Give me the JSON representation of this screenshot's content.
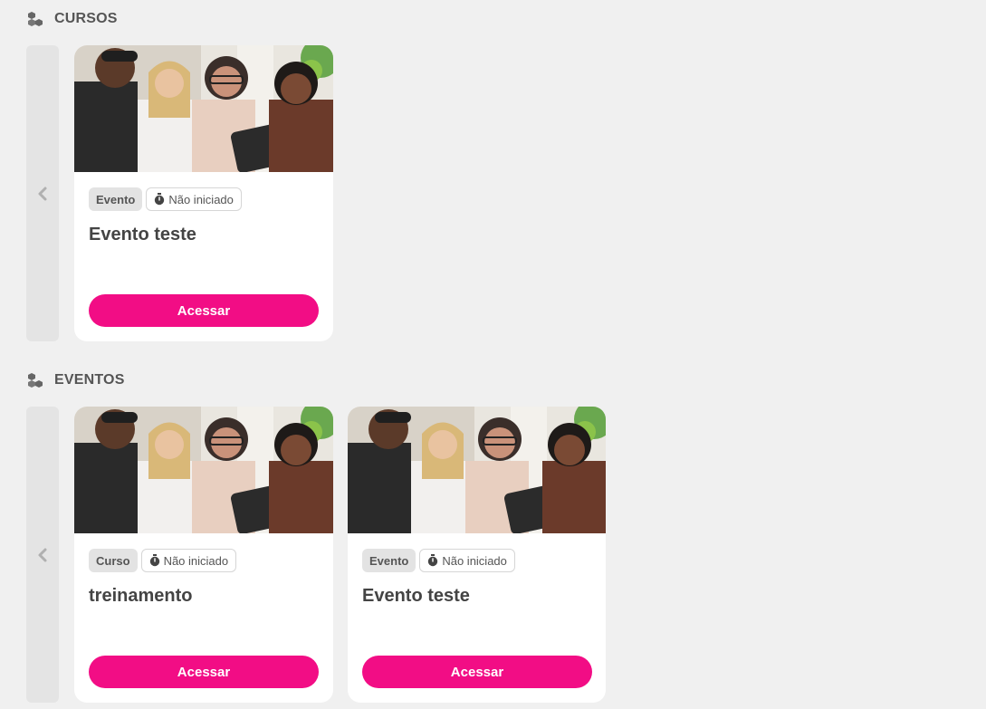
{
  "sections": [
    {
      "title": "CURSOS",
      "cards": [
        {
          "type_label": "Evento",
          "status_label": "Não iniciado",
          "title": "Evento teste",
          "button_label": "Acessar"
        }
      ]
    },
    {
      "title": "EVENTOS",
      "cards": [
        {
          "type_label": "Curso",
          "status_label": "Não iniciado",
          "title": "treinamento",
          "button_label": "Acessar"
        },
        {
          "type_label": "Evento",
          "status_label": "Não iniciado",
          "title": "Evento teste",
          "button_label": "Acessar"
        }
      ]
    }
  ],
  "icons": {
    "section": "cubes-icon",
    "prev": "chevron-left-icon",
    "status": "stopwatch-icon"
  },
  "colors": {
    "accent": "#f20d85",
    "background": "#f0f0f0",
    "card": "#ffffff",
    "tag_background": "#e3e3e3"
  }
}
